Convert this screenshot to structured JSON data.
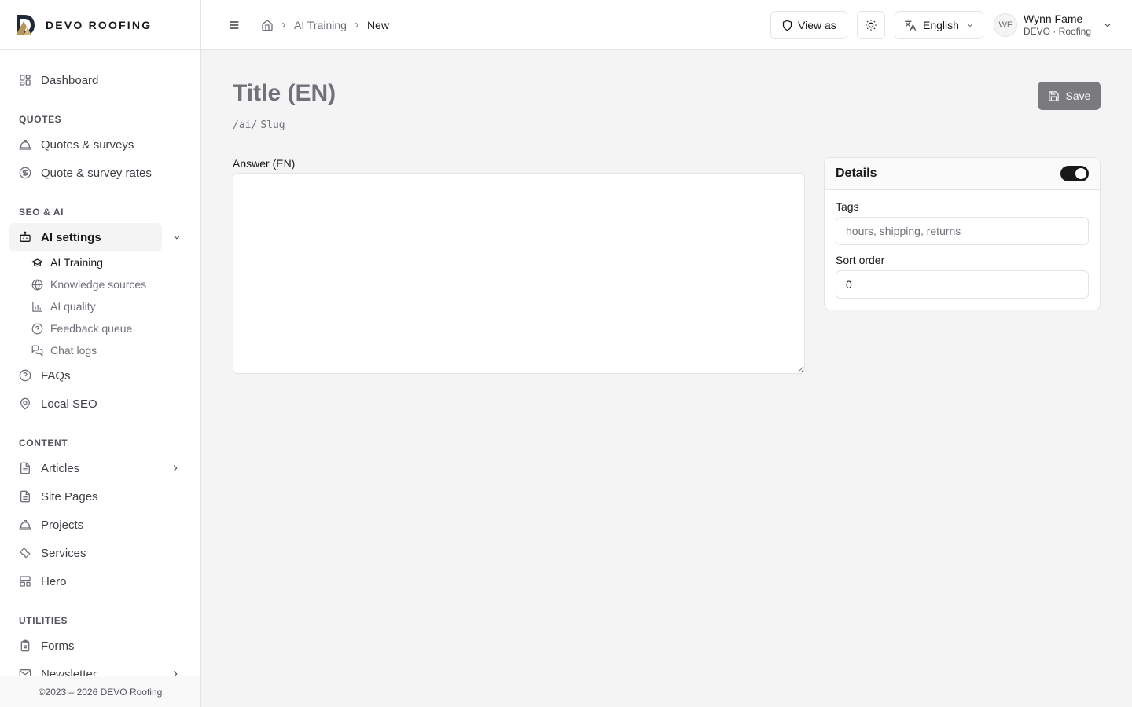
{
  "brand": {
    "name": "DEVO ROOFING"
  },
  "sidebar": {
    "dashboard": "Dashboard",
    "sections": {
      "quotes": "QUOTES",
      "seo_ai": "SEO & AI",
      "content": "CONTENT",
      "utilities": "UTILITIES"
    },
    "quotes_items": [
      "Quotes & surveys",
      "Quote & survey rates"
    ],
    "ai_settings": "AI settings",
    "ai_sub_items": [
      "AI Training",
      "Knowledge sources",
      "AI quality",
      "Feedback queue",
      "Chat logs"
    ],
    "seo_items": [
      "FAQs",
      "Local SEO"
    ],
    "content_items": [
      "Articles",
      "Site Pages",
      "Projects",
      "Services",
      "Hero"
    ],
    "utilities_items": [
      "Forms",
      "Newsletter"
    ],
    "footer": "©2023 – 2026 DEVO Roofing"
  },
  "header": {
    "breadcrumb": [
      "AI Training",
      "New"
    ],
    "view_as": "View as",
    "language": "English",
    "user": {
      "initials": "WF",
      "name": "Wynn Fame",
      "org": "DEVO · Roofing"
    }
  },
  "editor": {
    "title_placeholder": "Title (EN)",
    "slug_prefix": "/ai/",
    "slug_placeholder": "Slug",
    "save_label": "Save",
    "answer_label": "Answer (EN)",
    "answer_value": ""
  },
  "details": {
    "title": "Details",
    "published": true,
    "tags_label": "Tags",
    "tags_placeholder": "hours, shipping, returns",
    "sort_label": "Sort order",
    "sort_value": "0"
  },
  "colors": {
    "accent": "#18181b",
    "save_button": "#7a7a7f",
    "page_bg": "#f4f4f5",
    "border": "#e4e4e7"
  }
}
